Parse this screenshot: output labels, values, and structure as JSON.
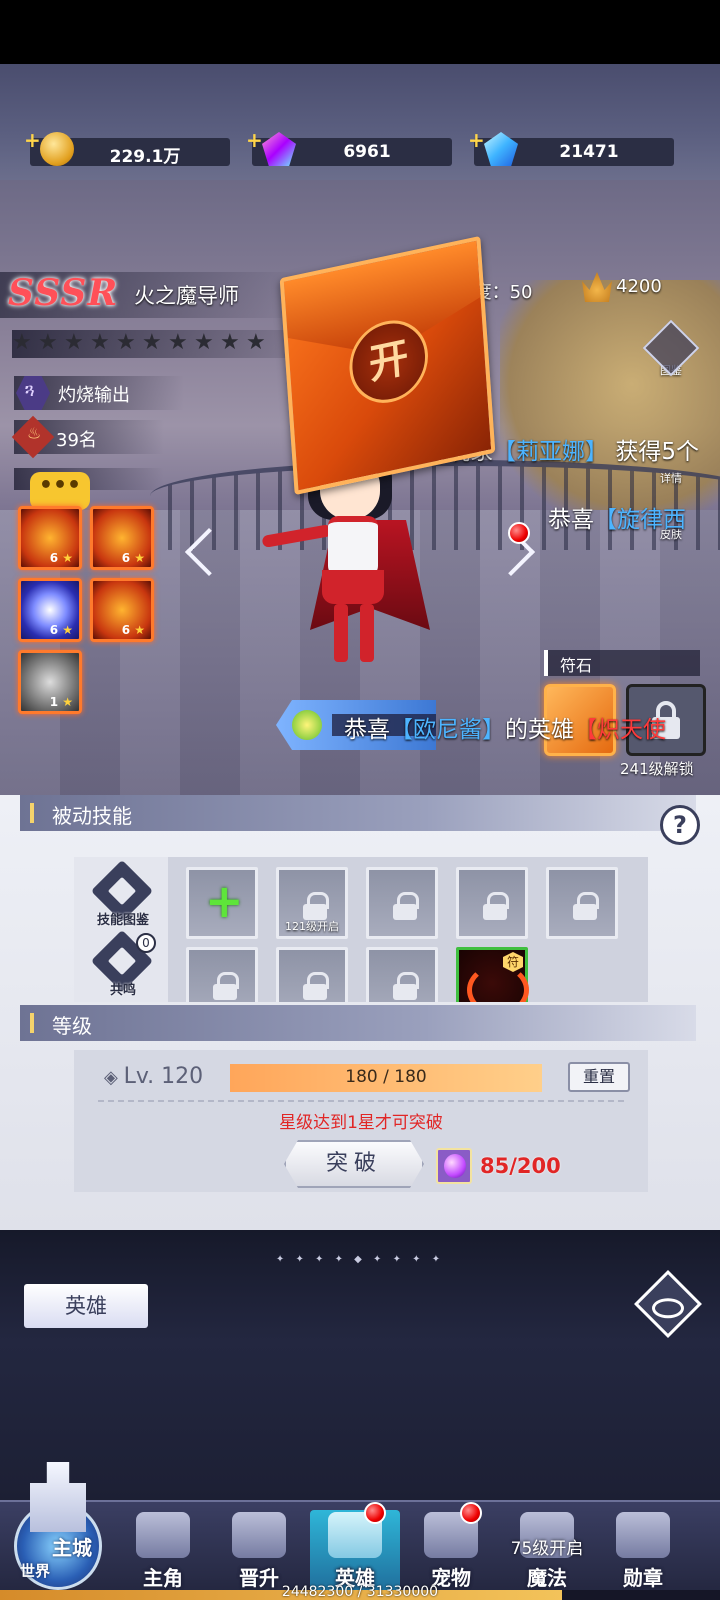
{
  "resources": {
    "gold": "229.1万",
    "purple_gems": "6961",
    "blue_gems": "21471"
  },
  "hero": {
    "rarity_tag": "SSSR",
    "name": "火之魔导师",
    "star_count": 10,
    "role": "灼烧输出",
    "rank": "39名",
    "rarity_label": "稀有度：",
    "rarity_value": "50",
    "power": "4200",
    "skill_bubble": "•••",
    "skills": [
      {
        "level": "6"
      },
      {
        "level": "6"
      },
      {
        "level": "6"
      },
      {
        "level": "6"
      },
      {
        "level": "1"
      }
    ],
    "box_glyph": "开"
  },
  "side_buttons": {
    "gallery": "图鉴",
    "details": "详情",
    "skin": "皮肤"
  },
  "marquee": [
    {
      "pre": "喜玩家",
      "name": "【莉亚娜】",
      "post": "获得5个"
    },
    {
      "pre": "恭喜",
      "name": "【旋律西",
      "post": ""
    },
    {
      "pre": "恭喜",
      "name": "【欧尼酱】",
      "mid": "的英雄",
      "hl": "【炽天使"
    }
  ],
  "runes": {
    "title": "符石",
    "unlock_text": "241级解锁"
  },
  "passive": {
    "title": "被动技能",
    "help": "?",
    "skill_gallery": "技能图鉴",
    "resonance": "共鸣",
    "resonance_count": "0",
    "slot_unlock_label": "121级开启",
    "tag": "符"
  },
  "level": {
    "title": "等级",
    "lv_text": "Lv. 120",
    "progress_text": "180 / 180",
    "progress": 1.0,
    "reset": "重置",
    "requirement": "星级达到1星才可突破",
    "break_label": "突破",
    "orb_count": "85/200"
  },
  "bottom": {
    "hero_tab": "英雄",
    "deco": "✦ ✦ ✦ ✦ ◆ ✦ ✦ ✦ ✦"
  },
  "nav": {
    "castle_label": "主城",
    "world_label": "世界",
    "items": [
      "主角",
      "晋升",
      "英雄",
      "宠物",
      "魔法",
      "勋章"
    ],
    "magic_lock": "75级开启"
  },
  "exp": {
    "text": "24482300 / 31330000",
    "progress": 0.781
  },
  "colors": {
    "rarity_red": "#ff5058",
    "highlight_blue": "#4db4ff",
    "warning_red": "#e12626",
    "active_tab": "#2fb6d8"
  }
}
